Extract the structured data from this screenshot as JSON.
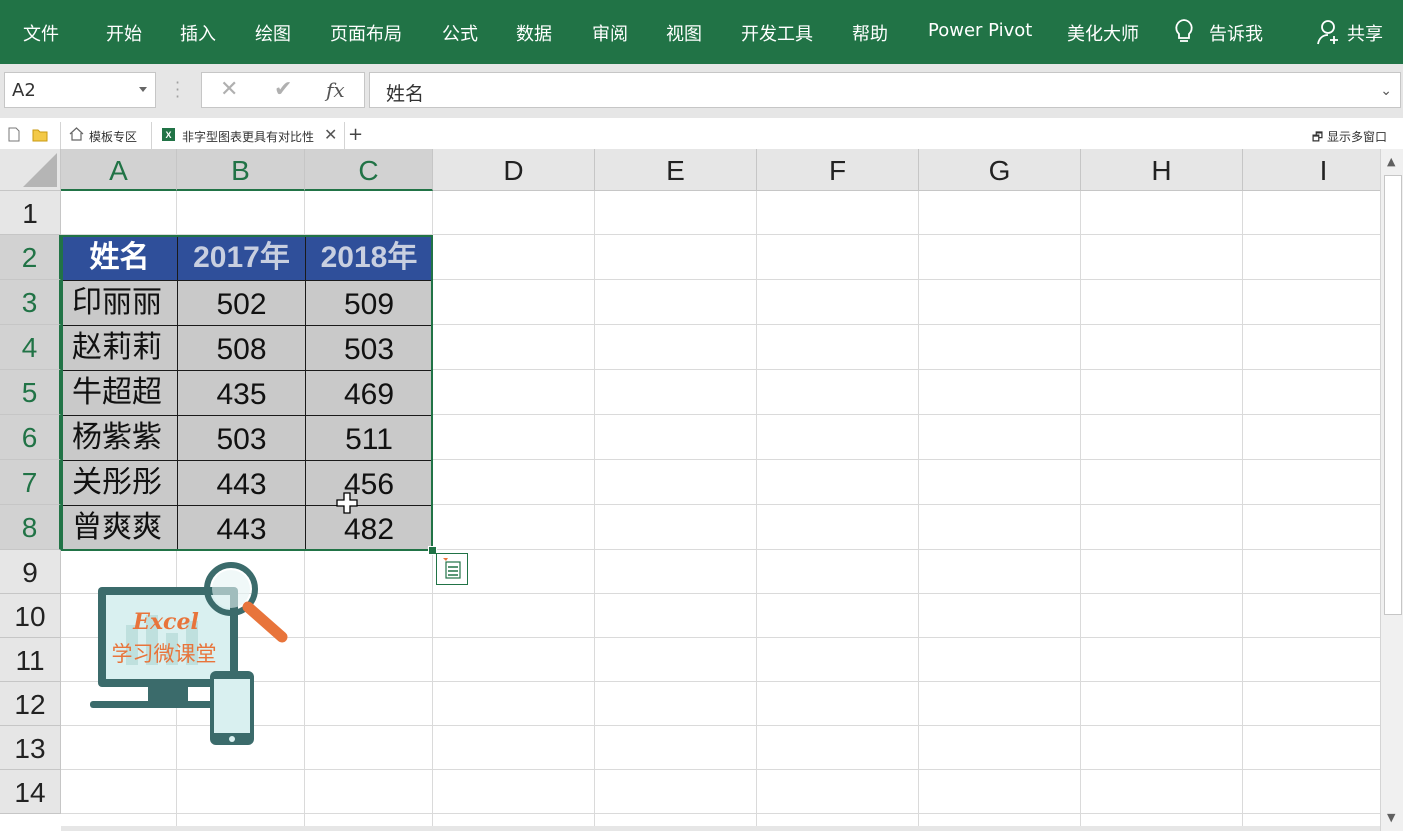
{
  "ribbon": {
    "tabs": [
      "文件",
      "开始",
      "插入",
      "绘图",
      "页面布局",
      "公式",
      "数据",
      "审阅",
      "视图",
      "开发工具",
      "帮助",
      "Power Pivot",
      "美化大师"
    ],
    "tell_me": "告诉我",
    "share": "共享",
    "color": "#217346"
  },
  "formula_bar": {
    "name_box": "A2",
    "formula": "姓名",
    "fx": "fx"
  },
  "doc_tabs": {
    "tab1": "模板专区",
    "tab2": "非字型图表更具有对比性",
    "multi_window": "显示多窗口"
  },
  "sheet": {
    "columns": [
      "A",
      "B",
      "C",
      "D",
      "E",
      "F",
      "G",
      "H",
      "I"
    ],
    "rows": [
      "1",
      "2",
      "3",
      "4",
      "5",
      "6",
      "7",
      "8",
      "9",
      "10",
      "11",
      "12",
      "13",
      "14"
    ],
    "active_cell": "A2"
  },
  "table": {
    "headers": [
      "姓名",
      "2017年",
      "2018年"
    ],
    "rows": [
      [
        "印丽丽",
        "502",
        "509"
      ],
      [
        "赵莉莉",
        "508",
        "503"
      ],
      [
        "牛超超",
        "435",
        "469"
      ],
      [
        "杨紫紫",
        "503",
        "511"
      ],
      [
        "关彤彤",
        "443",
        "456"
      ],
      [
        "曾爽爽",
        "443",
        "482"
      ]
    ],
    "header_color": "#2f4f9a",
    "body_color": "#c9c9c9"
  },
  "logo": {
    "text1": "Excel",
    "text2": "学习微课堂"
  }
}
